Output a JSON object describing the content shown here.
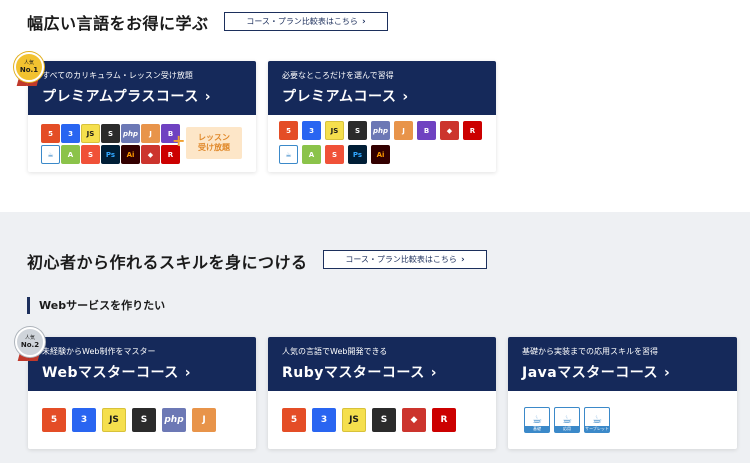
{
  "section1": {
    "title": "幅広い言語をお得に学ぶ",
    "compare": "コース・プラン比較表はこちら",
    "cards": [
      {
        "tag": "すべてのカリキュラム・レッスン受け放題",
        "name": "プレミアムプラスコース",
        "badge": {
          "top": "人気",
          "bottom": "No.1"
        },
        "extra": "レッスン\n受け放題"
      },
      {
        "tag": "必要なところだけを選んで習得",
        "name": "プレミアムコース"
      }
    ]
  },
  "section2": {
    "title": "初心者から作れるスキルを身につける",
    "compare": "コース・プラン比較表はこちら",
    "subtitle": "Webサービスを作りたい",
    "cards": [
      {
        "tag": "未経験からWeb制作をマスター",
        "name": "Webマスターコース",
        "badge": {
          "top": "人気",
          "bottom": "No.2"
        }
      },
      {
        "tag": "人気の言語でWeb開発できる",
        "name": "Rubyマスターコース"
      },
      {
        "tag": "基礎から実装までの応用スキルを習得",
        "name": "Javaマスターコース",
        "levels": [
          "基礎",
          "応用",
          "サーブレット"
        ]
      }
    ]
  },
  "chevron": "›",
  "icons": {
    "html": "5",
    "css": "3",
    "js": "JS",
    "sass": "S",
    "php": "php",
    "jq": "J",
    "bs": "B",
    "rb": "◆",
    "rails": "R",
    "java": "☕",
    "android": "A",
    "swift": "S",
    "ps": "Ps",
    "ai": "Ai"
  }
}
